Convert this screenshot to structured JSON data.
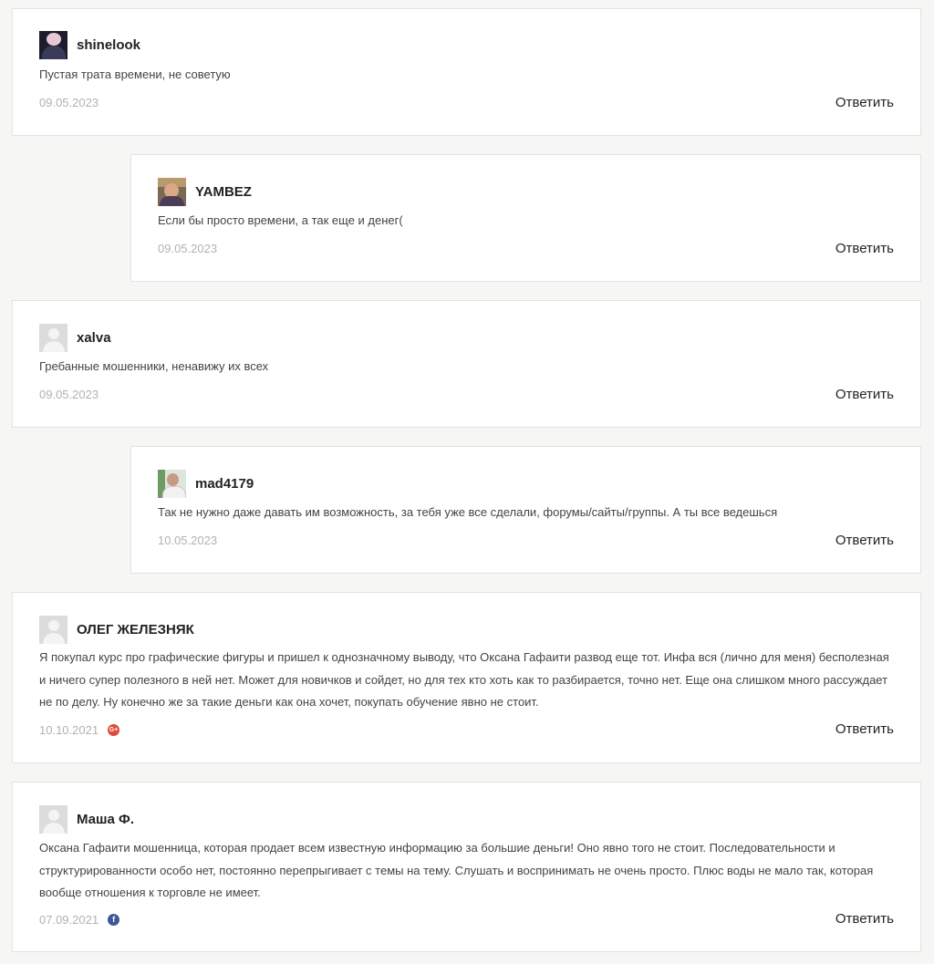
{
  "comments": [
    {
      "author": "shinelook",
      "text": "Пустая трата времени, не советую",
      "date": "09.05.2023",
      "reply": "Ответить"
    },
    {
      "author": "YAMBEZ",
      "text": "Если бы просто времени, а так еще и денег(",
      "date": "09.05.2023",
      "reply": "Ответить"
    },
    {
      "author": "xalva",
      "text": "Гребанные мошенники, ненавижу их всех",
      "date": "09.05.2023",
      "reply": "Ответить"
    },
    {
      "author": "mad4179",
      "text": "Так не нужно даже давать им возможность, за тебя уже все сделали, форумы/сайты/группы. А ты все ведешься",
      "date": "10.05.2023",
      "reply": "Ответить"
    },
    {
      "author": "ОЛЕГ ЖЕЛЕЗНЯК",
      "text": "Я покупал курс про графические фигуры и пришел к однозначному выводу, что Оксана Гафаити развод еще тот. Инфа вся (лично для меня) бесполезная и ничего супер полезного в ней нет. Может для новичков и сойдет, но для тех кто хоть как то разбирается, точно нет. Еще она слишком много рассуждает не по делу. Ну конечно же за такие деньги как она хочет, покупать обучение явно не стоит.",
      "date": "10.10.2021",
      "social_icon": "google-plus-icon",
      "social_glyph": "G+",
      "social_color": "#dd4b39",
      "reply": "Ответить"
    },
    {
      "author": "Маша Ф.",
      "text": "Оксана Гафаити мошенница, которая продает всем известную информацию за большие деньги! Оно явно того не стоит. Последовательности и структурированности особо нет, постоянно перепрыгивает с темы на тему. Слушать и воспринимать не очень просто. Плюс воды не мало так, которая вообще отношения к торговле не имеет.",
      "date": "07.09.2021",
      "social_icon": "facebook-icon",
      "social_glyph": "f",
      "social_color": "#3b5998",
      "reply": "Ответить"
    }
  ]
}
